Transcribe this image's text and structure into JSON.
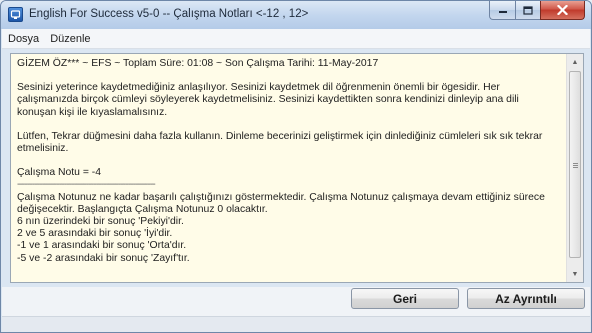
{
  "window": {
    "title": "English For Success v5-0 -- Çalışma Notları <-12 , 12>",
    "buttons": {
      "minimize": "minimize-icon",
      "maximize": "maximize-icon",
      "close": "close-icon"
    }
  },
  "menu": {
    "items": [
      {
        "label": "Dosya"
      },
      {
        "label": "Düzenle"
      }
    ]
  },
  "report": {
    "header": "GİZEM ÖZ*** ~ EFS ~ Toplam Süre: 01:08 ~ Son Çalışma Tarihi: 11-May-2017",
    "paragraph1": "Sesinizi yeterince kaydetmediğiniz anlaşılıyor.  Sesinizi kaydetmek dil öğrenmenin önemli bir ögesidir. Her çalışmanızda birçok cümleyi söyleyerek kaydetmelisiniz. Sesinizi kaydettikten sonra kendinizi dinleyip ana dili konuşan kişi ile kıyaslamalısınız.",
    "paragraph2": "Lütfen, Tekrar düğmesini daha fazla kullanın.  Dinleme becerinizi geliştirmek için dinlediğiniz cümleleri sık sık tekrar etmelisiniz.",
    "score_line": "Çalışma Notu = -4",
    "separator": "--------------------------------------------------------",
    "explanation": "Çalışma Notunuz ne kadar başarılı çalıştığınızı göstermektedir.  Çalışma Notunuz çalışmaya devam ettiğiniz sürece değişecektir.  Başlangıçta Çalışma Notunuz  0  olacaktır.",
    "scale": [
      " 6 nın üzerindeki bir sonuç 'Pekiyi'dir.",
      " 2 ve 5 arasındaki bir sonuç 'İyi'dir.",
      "  -1 ve 1 arasındaki bir sonuç 'Orta'dır.",
      " -5 ve -2 arasındaki bir sonuç 'Zayıf'tır."
    ]
  },
  "footer": {
    "back_label": "Geri",
    "detail_label": "Az Ayrıntılı"
  }
}
